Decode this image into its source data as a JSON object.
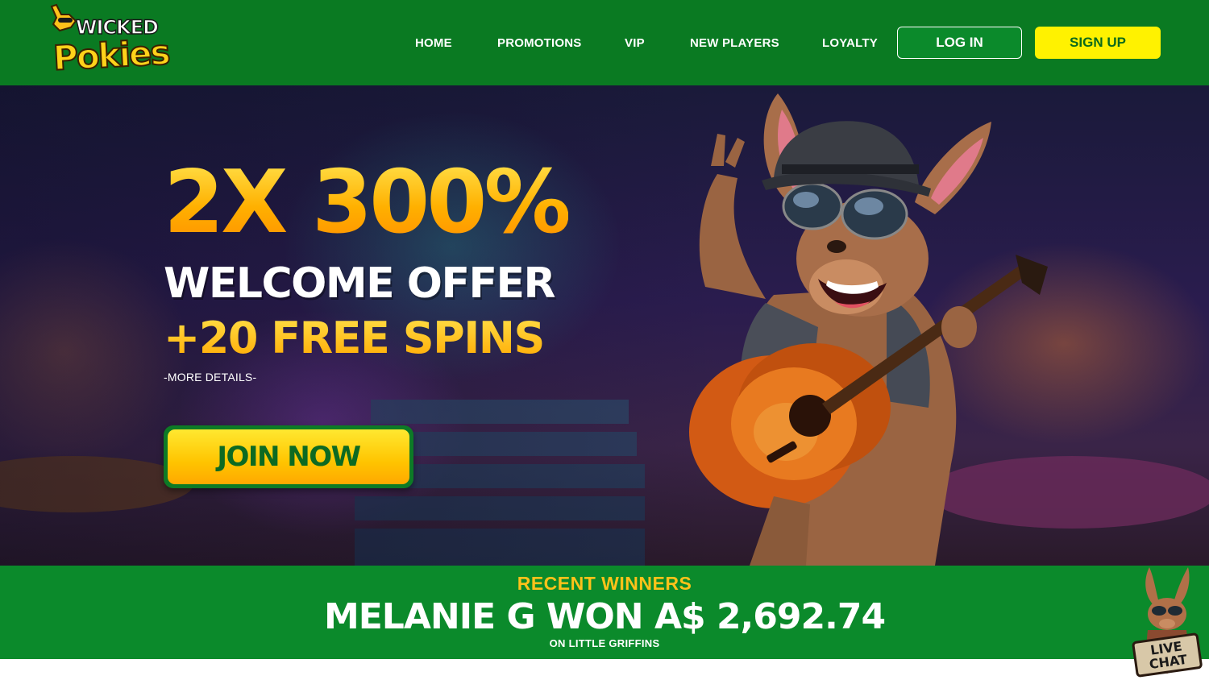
{
  "brand": {
    "logo_top": "WICKED",
    "logo_bottom": "Pokies"
  },
  "nav": {
    "items": [
      {
        "label": "HOME"
      },
      {
        "label": "PROMOTIONS"
      },
      {
        "label": "VIP"
      },
      {
        "label": "NEW PLAYERS"
      },
      {
        "label": "LOYALTY"
      }
    ],
    "login_label": "LOG IN",
    "signup_label": "SIGN UP"
  },
  "hero": {
    "headline": "2X 300%",
    "subline1": "WELCOME OFFER",
    "subline2": "+20 FREE SPINS",
    "more_details": "-MORE DETAILS-",
    "cta_label": "JOIN NOW"
  },
  "winners": {
    "title": "RECENT WINNERS",
    "main": "MELANIE G WON A$ 2,692.74",
    "sub": "ON LITTLE GRIFFINS"
  },
  "live_chat": {
    "line1": "LIVE",
    "line2": "CHAT"
  },
  "colors": {
    "header_green": "#0a7a22",
    "bar_green": "#0b8a2b",
    "signup_yellow": "#fff200",
    "gold": "#ffb300"
  }
}
